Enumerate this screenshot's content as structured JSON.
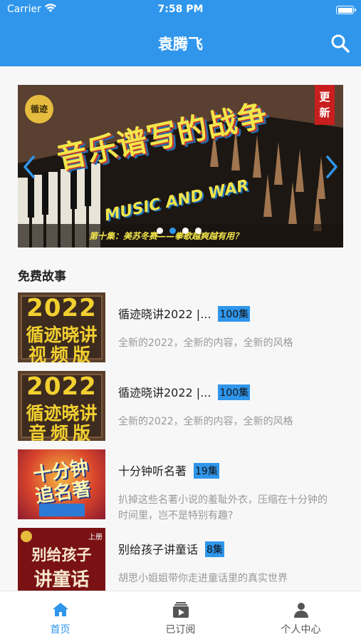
{
  "status_bar": {
    "carrier": "Carrier",
    "time": "7:58 PM"
  },
  "nav": {
    "title": "袁腾飞",
    "search_icon": "search-icon"
  },
  "banner": {
    "logo_text": "循迹",
    "tag": "更新",
    "headline": "音乐谱写的战争",
    "subheadline": "MUSIC AND WAR",
    "caption": "第十集：美苏冬赛——拳歌越爽越有用？",
    "active_dot": 1,
    "dot_count": 4
  },
  "section_title": "免费故事",
  "stories": [
    {
      "title": "循迹晓讲2022 |...",
      "badge": "100集",
      "desc": "全新的2022，全新的内容，全新的风格",
      "cover": {
        "year": "2022",
        "line1": "循迹晓讲",
        "line2": "视频版"
      }
    },
    {
      "title": "循迹晓讲2022 |...",
      "badge": "100集",
      "desc": "全新的2022，全新的内容，全新的风格",
      "cover": {
        "year": "2022",
        "line1": "循迹晓讲",
        "line2": "音频版"
      }
    },
    {
      "title": "十分钟听名著",
      "badge": "19集",
      "desc": "扒掉这些名著小说的羞耻外衣，压缩在十分钟的时间里，岂不是特别有趣?",
      "cover": {
        "line1": "十分钟",
        "line2": "追名著"
      }
    },
    {
      "title": "别给孩子讲童话",
      "badge": "8集",
      "desc": "胡思小姐姐带你走进童话里的真实世界",
      "cover": {
        "line1": "别给孩子",
        "line2": "讲童话",
        "pill": "上册"
      }
    }
  ],
  "tabs": [
    {
      "label": "首页",
      "icon": "home-icon",
      "active": true
    },
    {
      "label": "已订阅",
      "icon": "subscription-icon",
      "active": false
    },
    {
      "label": "个人中心",
      "icon": "person-icon",
      "active": false
    }
  ],
  "colors": {
    "primary": "#2f96ec",
    "badge": "#2f96ec"
  }
}
